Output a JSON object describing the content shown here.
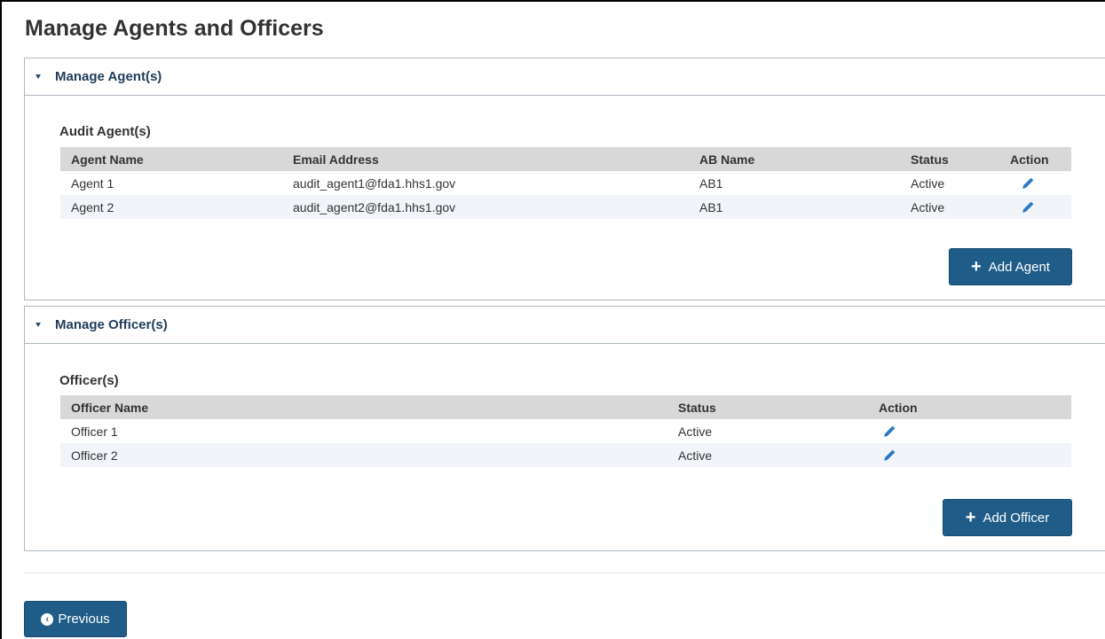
{
  "page": {
    "title": "Manage Agents and Officers"
  },
  "agents_panel": {
    "title": "Manage Agent(s)",
    "subtitle": "Audit Agent(s)",
    "columns": [
      "Agent Name",
      "Email Address",
      "AB Name",
      "Status",
      "Action"
    ],
    "rows": [
      {
        "name": "Agent 1",
        "email": "audit_agent1@fda1.hhs1.gov",
        "ab_name": "AB1",
        "status": "Active"
      },
      {
        "name": "Agent 2",
        "email": "audit_agent2@fda1.hhs1.gov",
        "ab_name": "AB1",
        "status": "Active"
      }
    ],
    "add_button_label": "Add Agent"
  },
  "officers_panel": {
    "title": "Manage Officer(s)",
    "subtitle": "Officer(s)",
    "columns": [
      "Officer Name",
      "Status",
      "Action"
    ],
    "rows": [
      {
        "name": "Officer 1",
        "status": "Active"
      },
      {
        "name": "Officer 2",
        "status": "Active"
      }
    ],
    "add_button_label": "Add Officer"
  },
  "footer": {
    "previous_label": "Previous"
  },
  "icons": {
    "edit": "pencil-icon",
    "add": "plus-icon",
    "previous": "chevron-left-circle-icon",
    "collapse": "caret-down-icon"
  },
  "colors": {
    "accent": "#1f5c88",
    "panel_title": "#1f3d5a",
    "icon_blue": "#2b78c5"
  }
}
